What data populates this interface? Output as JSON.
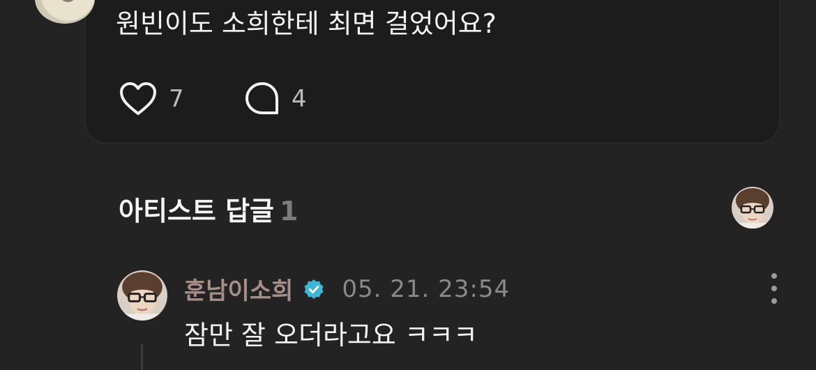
{
  "post": {
    "text": "원빈이도 소희한테 최면 걸었어요?",
    "like_count": "7",
    "comment_count": "4"
  },
  "artist_replies": {
    "title": "아티스트 답글",
    "count": "1"
  },
  "reply": {
    "author": "훈남이소희",
    "timestamp": "05. 21. 23:54",
    "text": "잠만 잘 오더라고요 ㅋㅋㅋ"
  },
  "icons": {
    "like": "heart-icon",
    "comment": "comment-bubble-icon",
    "verified": "verified-badge-icon",
    "more": "more-vertical-icon"
  },
  "colors": {
    "background": "#232323",
    "card": "#1c1c1c",
    "author_name": "#a88e88",
    "verified_badge": "#3fb6d3"
  }
}
